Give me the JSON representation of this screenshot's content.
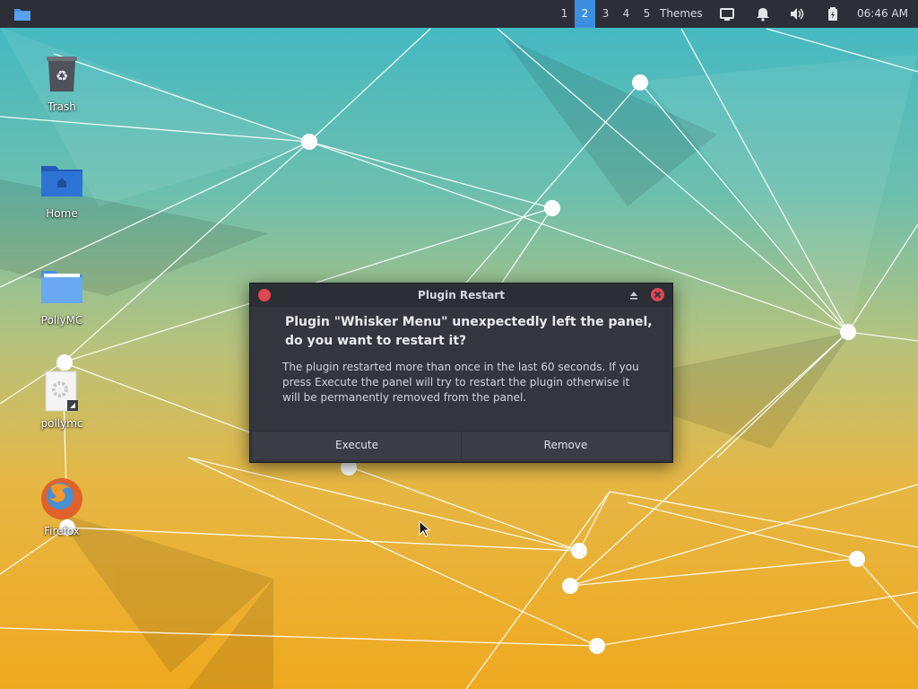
{
  "panel": {
    "workspaces": [
      {
        "label": "1",
        "active": false
      },
      {
        "label": "2",
        "active": true
      },
      {
        "label": "3",
        "active": false
      },
      {
        "label": "4",
        "active": false
      },
      {
        "label": "5",
        "active": false
      }
    ],
    "themes_label": "Themes",
    "tray_icons": [
      "display-icon",
      "notification-bell-icon",
      "volume-icon",
      "battery-icon"
    ],
    "clock": "06:46 AM",
    "accent_color": "#3b8ee0"
  },
  "desktop": {
    "icons": [
      {
        "label": "Trash",
        "icon": "trash-icon"
      },
      {
        "label": "Home",
        "icon": "home-folder-icon"
      },
      {
        "label": "PollyMC",
        "icon": "folder-icon"
      },
      {
        "label": "pollymc",
        "icon": "file-icon"
      },
      {
        "label": "Firefox",
        "icon": "firefox-icon"
      }
    ]
  },
  "dialog": {
    "title": "Plugin Restart",
    "headline": "Plugin \"Whisker Menu\" unexpectedly left the panel, do you want to restart it?",
    "body": "The plugin restarted more than once in the last 60 seconds. If you press Execute the panel will try to restart the plugin otherwise it will be permanently removed from the panel.",
    "buttons": {
      "execute": "Execute",
      "remove": "Remove"
    },
    "close_color": "#e0474f"
  }
}
